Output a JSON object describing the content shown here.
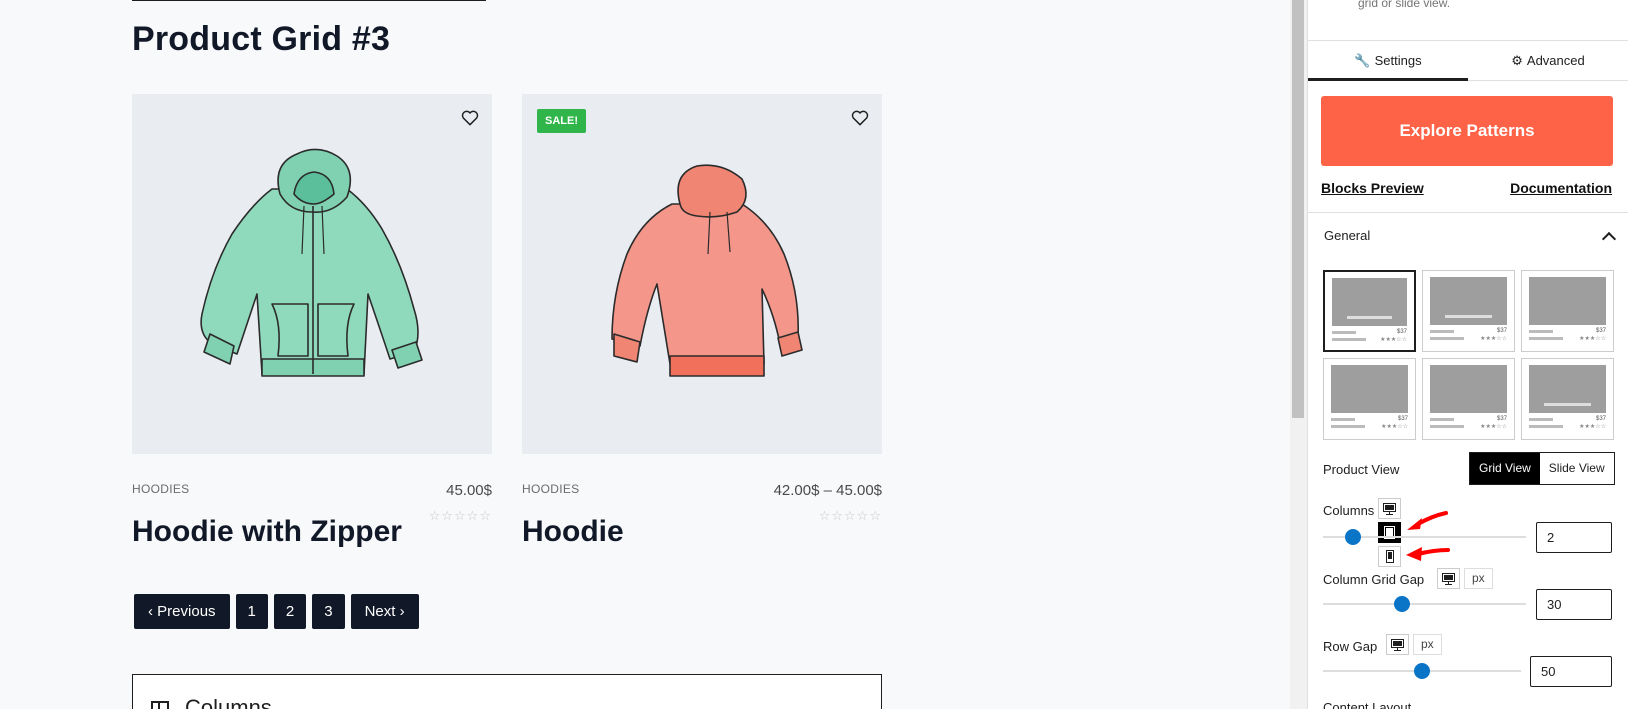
{
  "canvas": {
    "grid_title": "Product Grid #3",
    "products": [
      {
        "category": "HOODIES",
        "price": "45.00$",
        "name": "Hoodie with Zipper",
        "stars": "☆☆☆☆☆",
        "sale": "",
        "image": "mint-zip-hoodie"
      },
      {
        "category": "HOODIES",
        "price": "42.00$ – 45.00$",
        "name": "Hoodie",
        "stars": "☆☆☆☆☆",
        "sale": "SALE!",
        "image": "coral-hoodie"
      }
    ],
    "pagination": {
      "previous": "Previous",
      "pages": [
        "1",
        "2",
        "3"
      ],
      "next": "Next"
    },
    "columns_block_label": "Columns"
  },
  "sidebar": {
    "description": "grid or slide view.",
    "tabs": [
      {
        "label": "Settings",
        "icon": "wrench-icon"
      },
      {
        "label": "Advanced",
        "icon": "gear-icon"
      }
    ],
    "explore_button": "Explore Patterns",
    "links": {
      "preview": "Blocks Preview",
      "documentation": "Documentation"
    },
    "general_panel": "General",
    "layout_price": "$37",
    "layout_stars": "★★★☆☆",
    "product_view": {
      "label": "Product View",
      "options": [
        "Grid View",
        "Slide View"
      ],
      "selected": "Grid View"
    },
    "columns": {
      "label": "Columns",
      "value": "2",
      "slider": 0.15
    },
    "column_gap": {
      "label": "Column Grid Gap",
      "unit": "px",
      "value": "30",
      "slider": 0.39
    },
    "row_gap": {
      "label": "Row Gap",
      "unit": "px",
      "value": "50",
      "slider": 0.5
    },
    "next_section": "Content Layout"
  },
  "colors": {
    "accent": "#ff6347",
    "slider": "#0a74c7",
    "sale_badge": "#2fb54a",
    "annotation_arrow": "#ff0000"
  }
}
